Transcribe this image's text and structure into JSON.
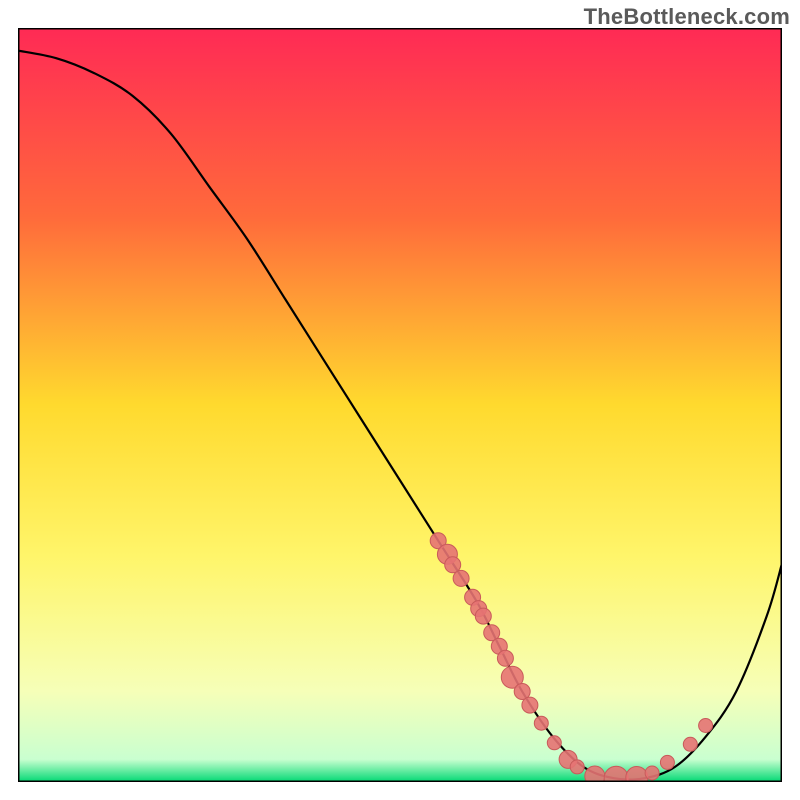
{
  "watermark": "TheBottleneck.com",
  "chart_data": {
    "type": "line",
    "title": "",
    "xlabel": "",
    "ylabel": "",
    "xlim": [
      0,
      100
    ],
    "ylim": [
      0,
      100
    ],
    "grid": false,
    "legend": false,
    "gradient_stops": [
      {
        "offset": 0.0,
        "color": "#ff2a55"
      },
      {
        "offset": 0.25,
        "color": "#ff6a3b"
      },
      {
        "offset": 0.5,
        "color": "#ffda2e"
      },
      {
        "offset": 0.7,
        "color": "#fff56a"
      },
      {
        "offset": 0.88,
        "color": "#f6ffb8"
      },
      {
        "offset": 0.97,
        "color": "#c9ffd0"
      },
      {
        "offset": 1.0,
        "color": "#00d873"
      }
    ],
    "series": [
      {
        "name": "bottleneck-curve",
        "x_pct": [
          0,
          5,
          10,
          15,
          20,
          25,
          30,
          35,
          40,
          45,
          50,
          55,
          60,
          63,
          66,
          70,
          74,
          78,
          82,
          86,
          90,
          94,
          98,
          100
        ],
        "y_pct": [
          97,
          96,
          94,
          91,
          86,
          79,
          72,
          64,
          56,
          48,
          40,
          32,
          24,
          18,
          12,
          6,
          2,
          0.5,
          0.5,
          2,
          6,
          12,
          22,
          29
        ]
      }
    ],
    "scatter": {
      "name": "data-points",
      "color_fill": "#e57373",
      "color_stroke": "#c85a5a",
      "points": [
        {
          "x_pct": 55.0,
          "y_pct": 32.0,
          "r": 8
        },
        {
          "x_pct": 56.2,
          "y_pct": 30.2,
          "r": 10
        },
        {
          "x_pct": 56.9,
          "y_pct": 28.8,
          "r": 8
        },
        {
          "x_pct": 58.0,
          "y_pct": 27.0,
          "r": 8
        },
        {
          "x_pct": 59.5,
          "y_pct": 24.5,
          "r": 8
        },
        {
          "x_pct": 60.3,
          "y_pct": 23.0,
          "r": 8
        },
        {
          "x_pct": 60.9,
          "y_pct": 22.0,
          "r": 8
        },
        {
          "x_pct": 62.0,
          "y_pct": 19.8,
          "r": 8
        },
        {
          "x_pct": 63.0,
          "y_pct": 18.0,
          "r": 8
        },
        {
          "x_pct": 63.8,
          "y_pct": 16.4,
          "r": 8
        },
        {
          "x_pct": 64.7,
          "y_pct": 13.9,
          "r": 11
        },
        {
          "x_pct": 66.0,
          "y_pct": 12.0,
          "r": 8
        },
        {
          "x_pct": 67.0,
          "y_pct": 10.2,
          "r": 8
        },
        {
          "x_pct": 68.5,
          "y_pct": 7.8,
          "r": 7
        },
        {
          "x_pct": 70.2,
          "y_pct": 5.2,
          "r": 7
        },
        {
          "x_pct": 72.0,
          "y_pct": 3.0,
          "r": 9
        },
        {
          "x_pct": 73.2,
          "y_pct": 2.0,
          "r": 7
        },
        {
          "x_pct": 75.5,
          "y_pct": 0.8,
          "r": 10
        },
        {
          "x_pct": 78.3,
          "y_pct": 0.5,
          "r": 12
        },
        {
          "x_pct": 81.0,
          "y_pct": 0.6,
          "r": 11
        },
        {
          "x_pct": 83.0,
          "y_pct": 1.2,
          "r": 7
        },
        {
          "x_pct": 85.0,
          "y_pct": 2.6,
          "r": 7
        },
        {
          "x_pct": 88.0,
          "y_pct": 5.0,
          "r": 7
        },
        {
          "x_pct": 90.0,
          "y_pct": 7.5,
          "r": 7
        }
      ]
    }
  }
}
